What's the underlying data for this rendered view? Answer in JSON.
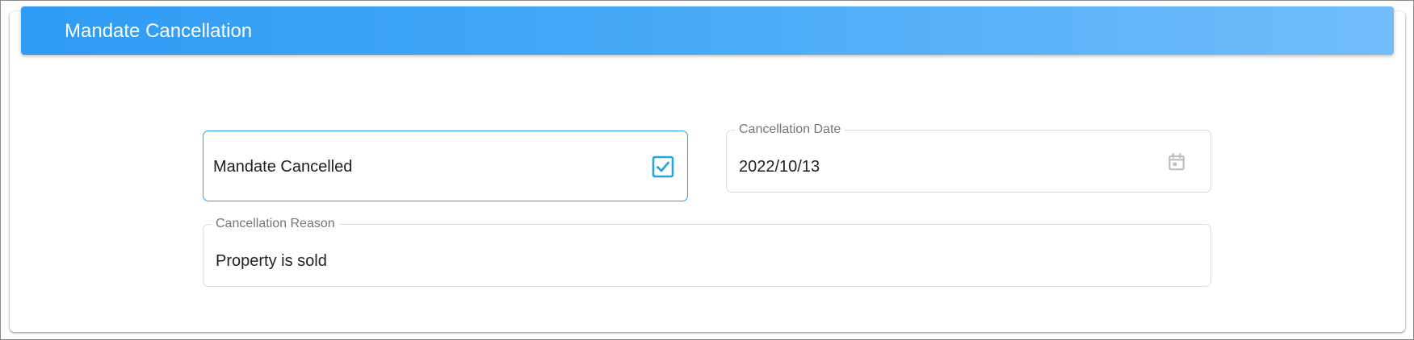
{
  "header": {
    "title": "Mandate Cancellation"
  },
  "form": {
    "mandate_cancelled": {
      "label": "Mandate Cancelled",
      "checked": true,
      "icon": "checkbox-checked-icon"
    },
    "cancellation_date": {
      "label": "Cancellation Date",
      "value": "2022/10/13",
      "icon": "calendar-icon"
    },
    "cancellation_reason": {
      "label": "Cancellation Reason",
      "value": "Property is sold"
    }
  },
  "colors": {
    "header_gradient_start": "#2e9bf4",
    "header_gradient_end": "#72bdfb",
    "accent": "#29a3dd",
    "text": "#212121",
    "muted": "#757575"
  }
}
